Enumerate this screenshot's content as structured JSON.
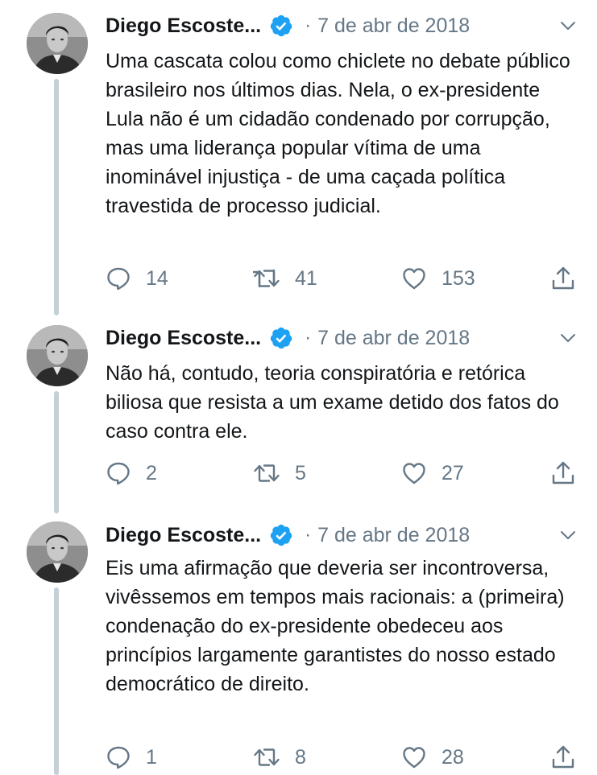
{
  "tweets": [
    {
      "author": "Diego Escoste...",
      "separator": "·",
      "date": "7 de abr de 2018",
      "text": "Uma cascata colou como chiclete no debate público brasileiro nos últimos dias. Nela, o ex-presidente Lula não é um cidadão condenado por corrupção, mas uma liderança popular vítima de uma inominável injustiça - de uma caçada política travestida de processo judicial.",
      "replies": "14",
      "retweets": "41",
      "likes": "153"
    },
    {
      "author": "Diego Escoste...",
      "separator": "·",
      "date": "7 de abr de 2018",
      "text": "Não há, contudo, teoria conspiratória e retórica biliosa que resista a um exame detido dos fatos do caso contra ele.",
      "replies": "2",
      "retweets": "5",
      "likes": "27"
    },
    {
      "author": "Diego Escoste...",
      "separator": "·",
      "date": "7 de abr de 2018",
      "text": "Eis uma afirmação que deveria ser incontroversa, vivêssemos em tempos mais racionais: a (primeira) condenação do ex-presidente obedeceu aos princípios largamente garantistes do nosso estado democrático de direito.",
      "replies": "1",
      "retweets": "8",
      "likes": "28"
    }
  ],
  "icons": {
    "verified": "verified-badge-icon",
    "caret": "chevron-down-icon",
    "reply": "reply-icon",
    "retweet": "retweet-icon",
    "like": "heart-icon",
    "share": "share-icon"
  },
  "colors": {
    "text": "#14171a",
    "secondary": "#657786",
    "verified": "#1da1f2",
    "thread_line": "#c4cfd6"
  }
}
